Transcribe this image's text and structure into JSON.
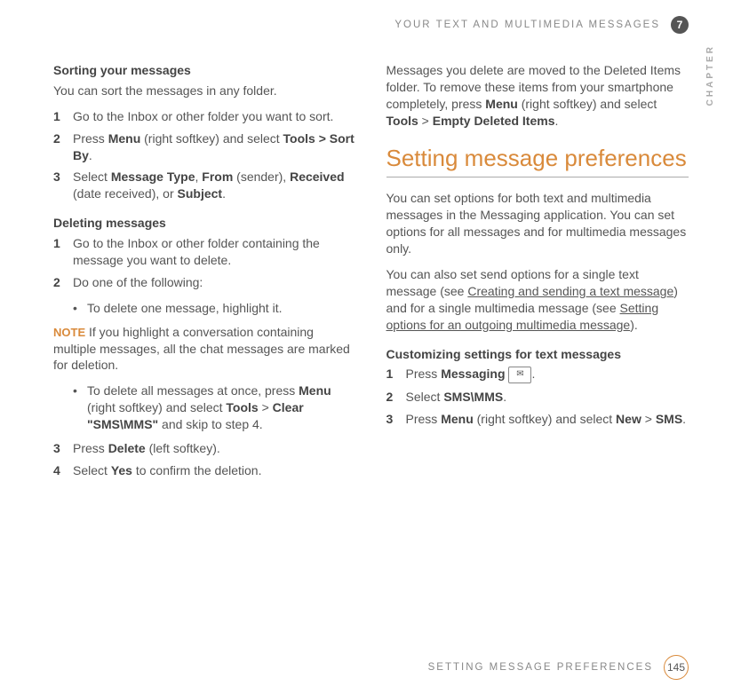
{
  "header": {
    "title": "YOUR TEXT AND MULTIMEDIA MESSAGES",
    "chapter_num": "7",
    "chapter_label": "CHAPTER"
  },
  "left": {
    "sorting_h": "Sorting your messages",
    "sorting_intro": "You can sort the messages in any folder.",
    "sort_1": "Go to the Inbox or other folder you want to sort.",
    "sort_2a": "Press ",
    "sort_2b": "Menu",
    "sort_2c": " (right softkey) and select ",
    "sort_2d": "Tools > Sort By",
    "sort_2e": ".",
    "sort_3a": "Select ",
    "sort_3b": "Message Type",
    "sort_3c": ", ",
    "sort_3d": "From",
    "sort_3e": " (sender), ",
    "sort_3f": "Received",
    "sort_3g": " (date received), or ",
    "sort_3h": "Subject",
    "sort_3i": ".",
    "deleting_h": "Deleting messages",
    "del_1": "Go to the Inbox or other folder containing the message you want to delete.",
    "del_2": "Do one of the following:",
    "del_2_b1": "To delete one message, highlight it.",
    "note_label": "NOTE",
    "note_text": " If you highlight a conversation containing multiple messages, all the chat messages are marked for deletion.",
    "del_2_b2a": "To delete all messages at once, press ",
    "del_2_b2b": "Menu",
    "del_2_b2c": " (right softkey) and select ",
    "del_2_b2d": "Tools",
    "del_2_b2e": " > ",
    "del_2_b2f": "Clear \"SMS\\MMS\"",
    "del_2_b2g": " and skip to step 4.",
    "del_3a": "Press ",
    "del_3b": "Delete",
    "del_3c": " (left softkey).",
    "del_4a": "Select ",
    "del_4b": "Yes",
    "del_4c": " to confirm the deletion."
  },
  "right": {
    "para1a": "Messages you delete are moved to the Deleted Items folder. To remove these items from your smartphone completely, press ",
    "para1b": "Menu",
    "para1c": " (right softkey) and select ",
    "para1d": "Tools",
    "para1e": " > ",
    "para1f": "Empty Deleted Items",
    "para1g": ".",
    "section_title": "Setting message preferences",
    "para2": "You can set options for both text and multimedia messages in the Messaging application. You can set options for all messages and for multimedia messages only.",
    "para3a": "You can also set send options for a single text message (see ",
    "para3b": "Creating and sending a text message",
    "para3c": ") and for a single multimedia message (see ",
    "para3d": "Setting options for an outgoing multimedia message",
    "para3e": ").",
    "custom_h": "Customizing settings for text messages",
    "c1a": "Press ",
    "c1b": "Messaging",
    "c1c": ".",
    "c2a": "Select ",
    "c2b": "SMS\\MMS",
    "c2c": ".",
    "c3a": "Press ",
    "c3b": "Menu",
    "c3c": " (right softkey) and select ",
    "c3d": "New",
    "c3e": " > ",
    "c3f": "SMS",
    "c3g": "."
  },
  "footer": {
    "title": "SETTING MESSAGE PREFERENCES",
    "page": "145"
  }
}
